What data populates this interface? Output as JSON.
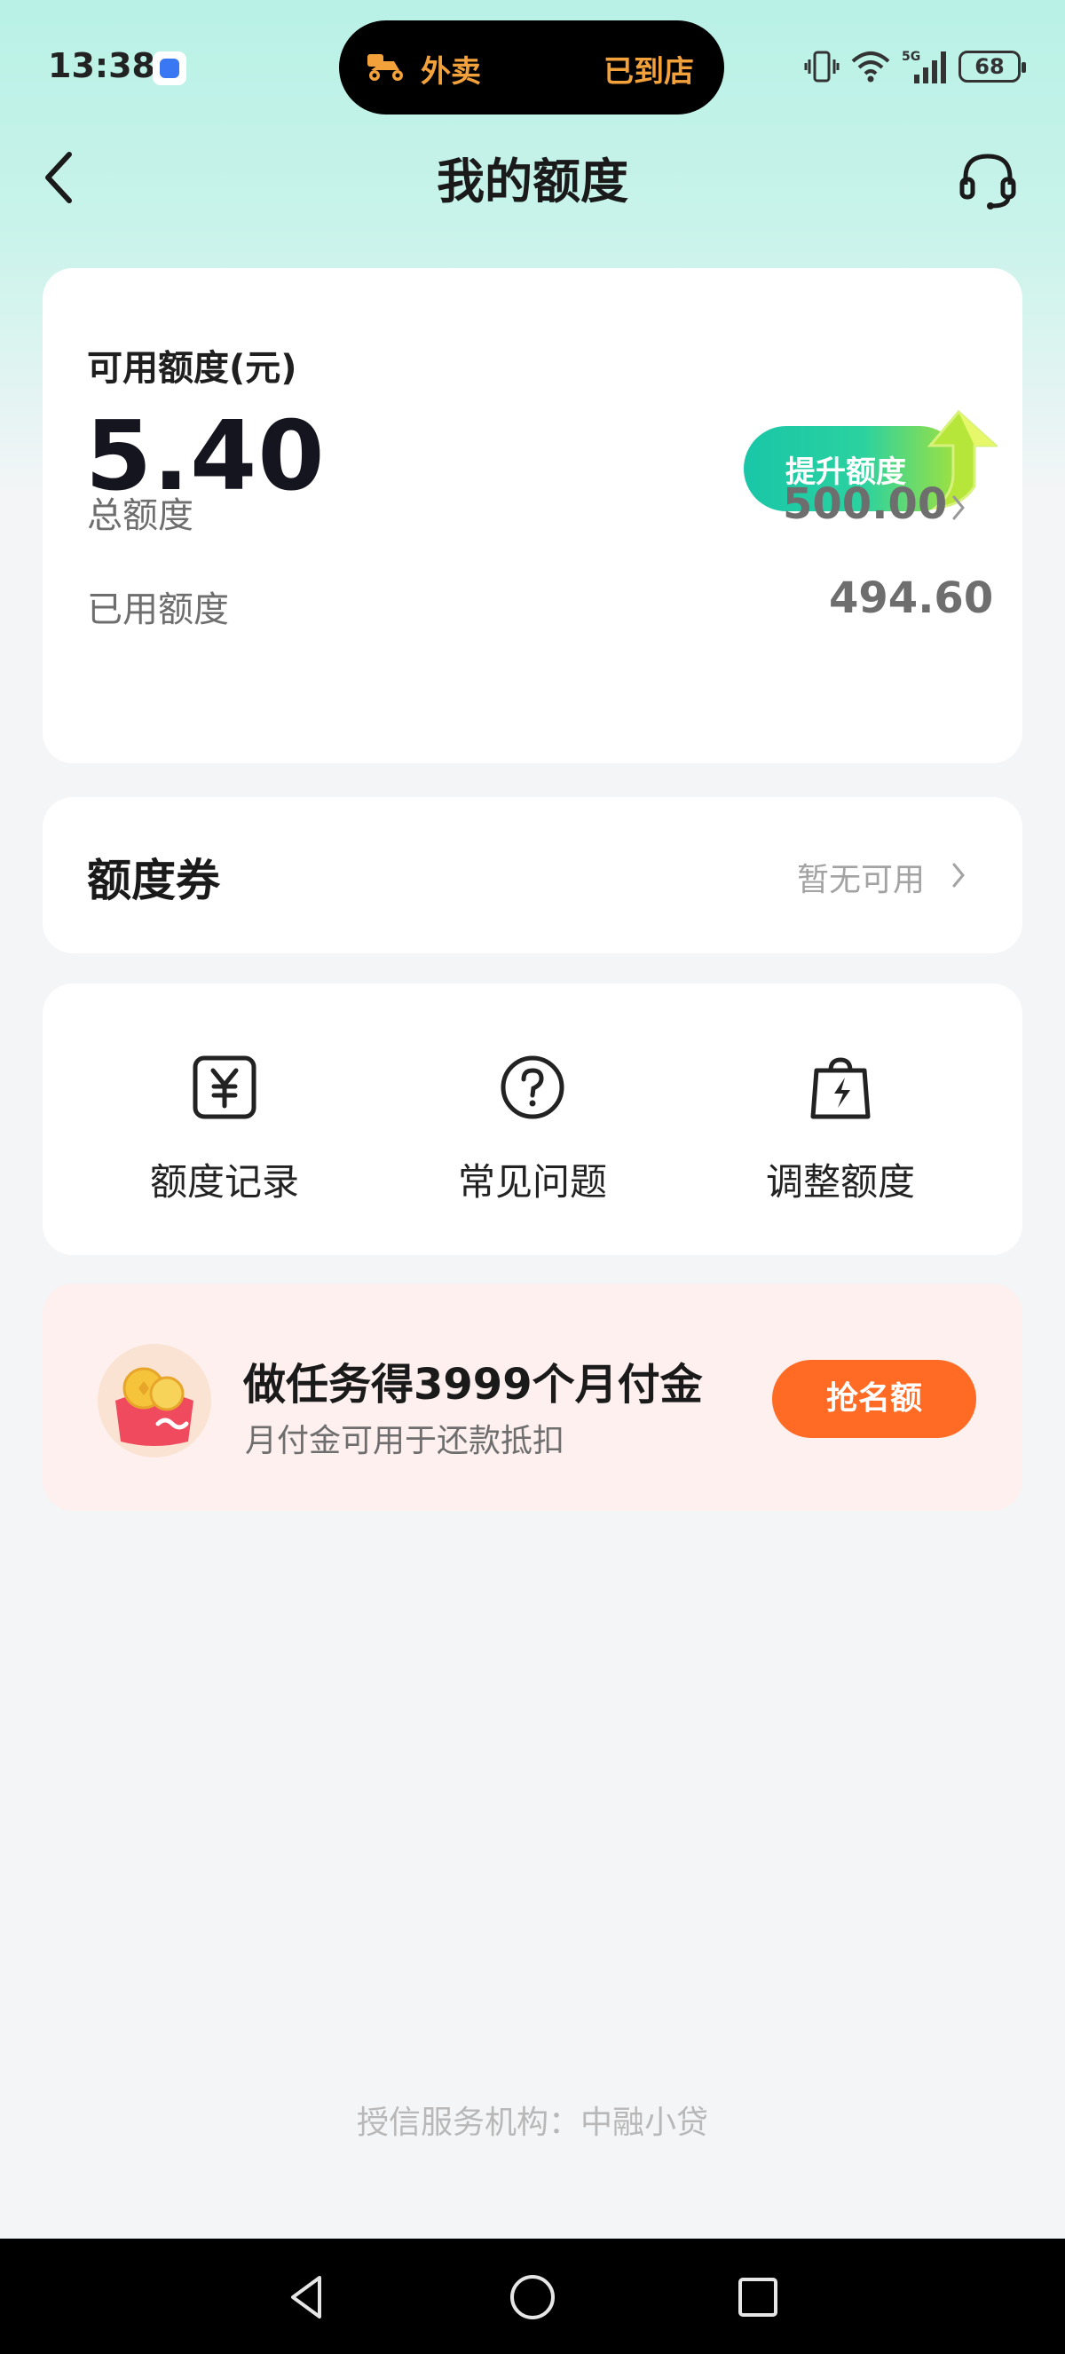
{
  "status_bar": {
    "time": "13:38",
    "pill_left": "外卖",
    "pill_right": "已到店",
    "network": "5G",
    "battery": "68"
  },
  "header": {
    "title": "我的额度",
    "back_icon": "chevron-left-icon",
    "support_icon": "headset-icon"
  },
  "credit": {
    "available_label": "可用额度(元)",
    "available_amount": "5.40",
    "raise_button": "提升额度",
    "total_label": "总额度",
    "total_value": "500.00",
    "used_label": "已用额度",
    "used_value": "494.60"
  },
  "coupon": {
    "title": "额度券",
    "status": "暂无可用"
  },
  "menu": {
    "items": [
      {
        "label": "额度记录",
        "icon": "yuan-record-icon"
      },
      {
        "label": "常见问题",
        "icon": "question-circle-icon"
      },
      {
        "label": "调整额度",
        "icon": "lightning-bag-icon"
      }
    ]
  },
  "promo": {
    "title": "做任务得3999个月付金",
    "subtitle": "月付金可用于还款抵扣",
    "button": "抢名额"
  },
  "footer": {
    "text": "授信服务机构：中融小贷"
  },
  "colors": {
    "header_bg": "#b9f1e6",
    "raise_gradient_start": "#19c6a7",
    "raise_gradient_end": "#a6e23a",
    "promo_bg": "#fdf0ee",
    "promo_button": "#ff6a24",
    "pill_text": "#f3a23b"
  }
}
